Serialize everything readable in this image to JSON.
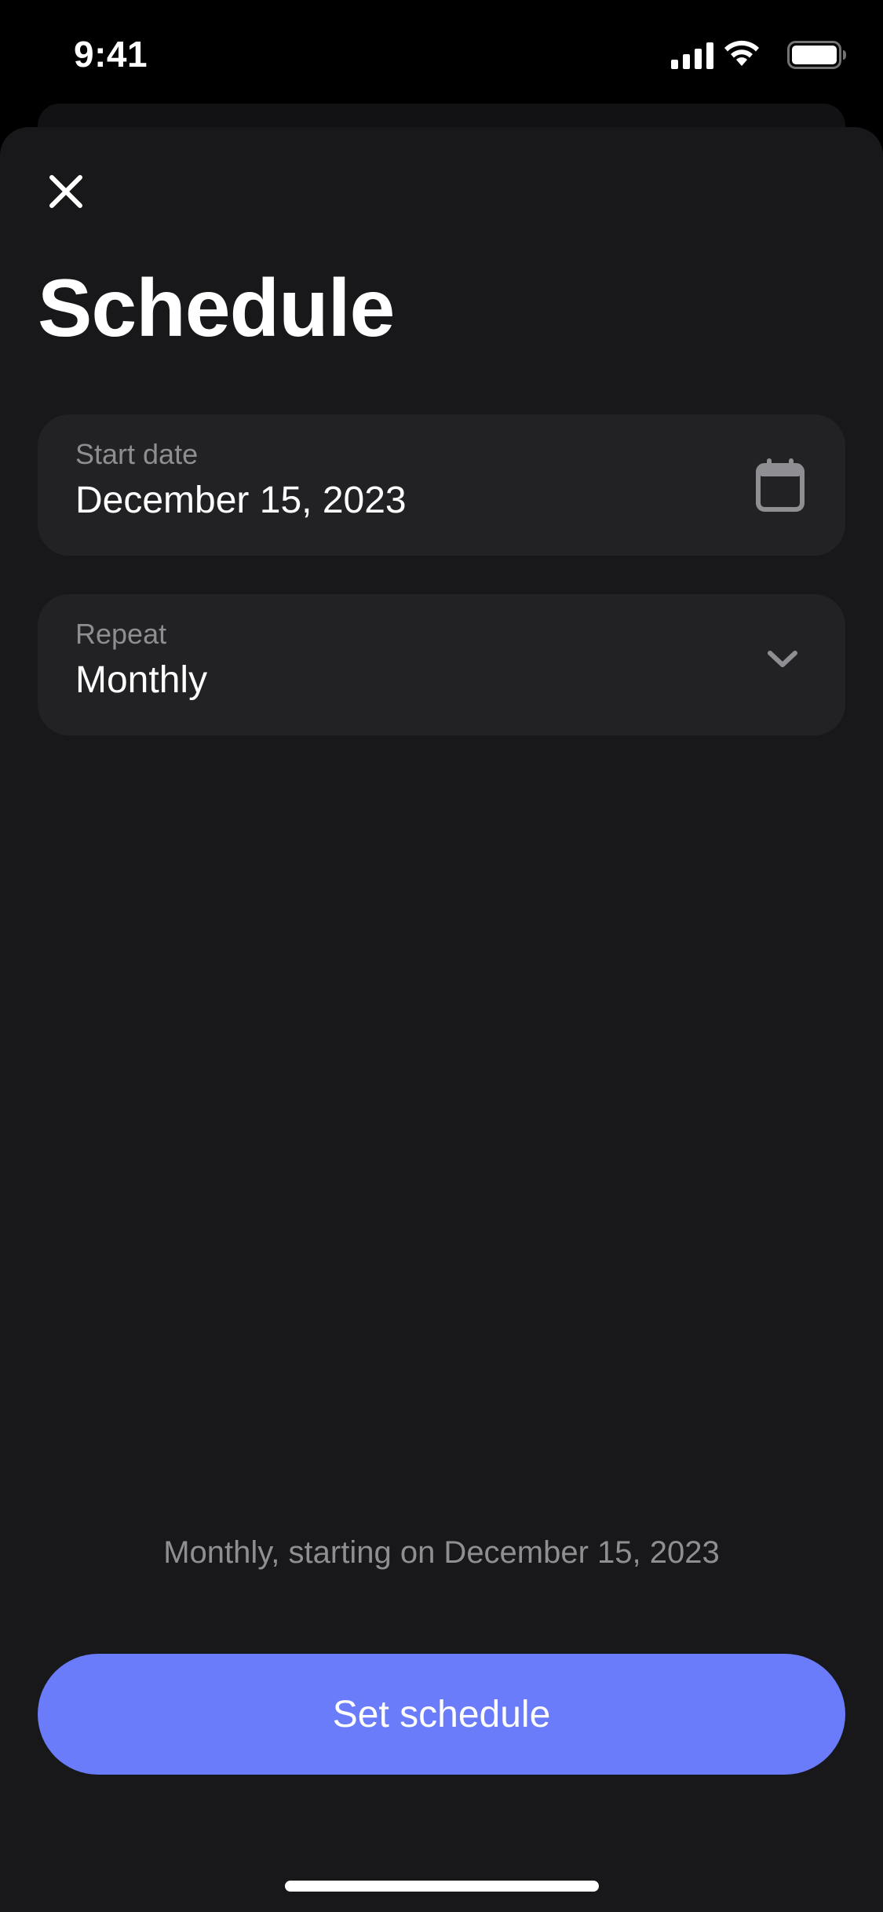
{
  "status_bar": {
    "time": "9:41",
    "icons": [
      "cellular-signal-icon",
      "wifi-icon",
      "battery-icon"
    ]
  },
  "header": {
    "close_icon": "close-icon",
    "title": "Schedule"
  },
  "form": {
    "start_date": {
      "label": "Start date",
      "value": "December 15, 2023",
      "icon": "calendar-icon"
    },
    "repeat": {
      "label": "Repeat",
      "value": "Monthly",
      "icon": "chevron-down-icon"
    }
  },
  "summary": "Monthly, starting on December 15, 2023",
  "actions": {
    "set_schedule_label": "Set schedule"
  },
  "colors": {
    "background": "#18181b",
    "field_background": "#222224",
    "accent": "#6a7cf9",
    "secondary_text": "#8e8e93"
  }
}
